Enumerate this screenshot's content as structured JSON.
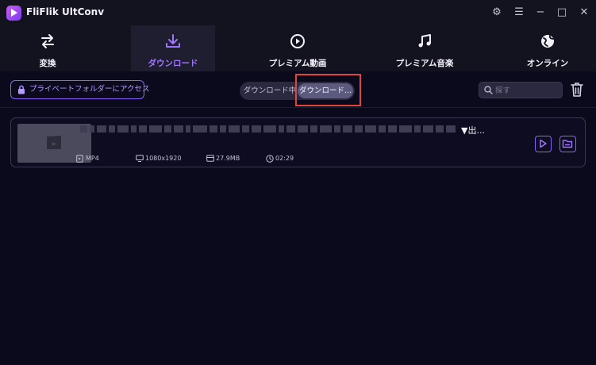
{
  "app": {
    "title": "FliFlik UltConv"
  },
  "window_controls": [
    {
      "icon": "gear-icon",
      "glyph": "⚙"
    },
    {
      "icon": "menu-icon",
      "glyph": "☰"
    },
    {
      "icon": "minimize-icon",
      "glyph": "−"
    },
    {
      "icon": "maximize-icon",
      "glyph": "□"
    },
    {
      "icon": "close-icon",
      "glyph": "✕"
    }
  ],
  "tabs": [
    {
      "label": "変換",
      "icon": "convert-icon"
    },
    {
      "label": "ダウンロード",
      "icon": "download-icon",
      "active": true
    },
    {
      "label": "プレミアム動画",
      "icon": "play-circle-icon"
    },
    {
      "label": "プレミアム音楽",
      "icon": "music-note-icon"
    },
    {
      "label": "オンライン",
      "icon": "globe-icon"
    }
  ],
  "toolbar": {
    "private_folder_label": "プライベートフォルダーにアクセス",
    "segment": {
      "downloading": "ダウンロード中",
      "downloaded": "ダウンロード..."
    },
    "search_placeholder": "探す"
  },
  "item": {
    "title_visible_suffix": "▼出...",
    "format": "MP4",
    "resolution": "1080x1920",
    "size": "27.9MB",
    "duration": "02:29"
  },
  "colors": {
    "accent": "#8c63f6",
    "highlight": "#e0473a",
    "background": "#0b0a1d"
  }
}
